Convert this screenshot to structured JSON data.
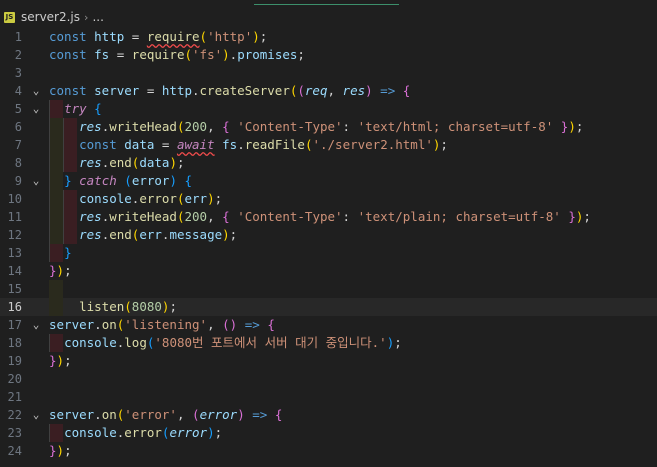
{
  "breadcrumb": {
    "file_badge": "JS",
    "file_name": "server2.js",
    "chevron": "›",
    "ellipsis": "..."
  },
  "editor": {
    "current_line": 16,
    "lines": [
      {
        "n": "1",
        "fold": "",
        "tokens": [
          [
            "kw",
            "const "
          ],
          [
            "var",
            "http"
          ],
          [
            "op",
            " = "
          ],
          [
            "fn squig",
            "require"
          ],
          [
            "brk1",
            "("
          ],
          [
            "str",
            "'http'"
          ],
          [
            "brk1",
            ")"
          ],
          [
            "op",
            ";"
          ]
        ]
      },
      {
        "n": "2",
        "fold": "",
        "tokens": [
          [
            "kw",
            "const "
          ],
          [
            "var",
            "fs"
          ],
          [
            "op",
            " = "
          ],
          [
            "fn",
            "require"
          ],
          [
            "brk1",
            "("
          ],
          [
            "str",
            "'fs'"
          ],
          [
            "brk1",
            ")"
          ],
          [
            "op",
            "."
          ],
          [
            "var",
            "promises"
          ],
          [
            "op",
            ";"
          ]
        ]
      },
      {
        "n": "3",
        "fold": "",
        "tokens": []
      },
      {
        "n": "4",
        "fold": "⌄",
        "tokens": [
          [
            "kw",
            "const "
          ],
          [
            "var",
            "server"
          ],
          [
            "op",
            " = "
          ],
          [
            "var",
            "http"
          ],
          [
            "op",
            "."
          ],
          [
            "fn",
            "createServer"
          ],
          [
            "brk1",
            "("
          ],
          [
            "brk2",
            "("
          ],
          [
            "param",
            "req"
          ],
          [
            "op",
            ", "
          ],
          [
            "param",
            "res"
          ],
          [
            "brk2",
            ")"
          ],
          [
            "kw",
            " => "
          ],
          [
            "brk2",
            "{"
          ]
        ]
      },
      {
        "n": "5",
        "fold": "⌄",
        "tokens": [
          [
            "op",
            "  "
          ],
          [
            "ctl",
            "try"
          ],
          [
            "op",
            " "
          ],
          [
            "brk3",
            "{"
          ]
        ]
      },
      {
        "n": "6",
        "fold": "",
        "tokens": [
          [
            "op",
            "    "
          ],
          [
            "param",
            "res"
          ],
          [
            "op",
            "."
          ],
          [
            "fn",
            "writeHead"
          ],
          [
            "brk1",
            "("
          ],
          [
            "num",
            "200"
          ],
          [
            "op",
            ", "
          ],
          [
            "brk2",
            "{ "
          ],
          [
            "str",
            "'Content-Type'"
          ],
          [
            "op",
            ": "
          ],
          [
            "str",
            "'text/html; charset=utf-8'"
          ],
          [
            "brk2",
            " }"
          ],
          [
            "brk1",
            ")"
          ],
          [
            "op",
            ";"
          ]
        ]
      },
      {
        "n": "7",
        "fold": "",
        "tokens": [
          [
            "op",
            "    "
          ],
          [
            "kw",
            "const "
          ],
          [
            "var",
            "data"
          ],
          [
            "op",
            " = "
          ],
          [
            "ctl squig",
            "await"
          ],
          [
            "op",
            " "
          ],
          [
            "var",
            "fs"
          ],
          [
            "op",
            "."
          ],
          [
            "fn",
            "readFile"
          ],
          [
            "brk1",
            "("
          ],
          [
            "str",
            "'./server2.html'"
          ],
          [
            "brk1",
            ")"
          ],
          [
            "op",
            ";"
          ]
        ]
      },
      {
        "n": "8",
        "fold": "",
        "tokens": [
          [
            "op",
            "    "
          ],
          [
            "param",
            "res"
          ],
          [
            "op",
            "."
          ],
          [
            "fn",
            "end"
          ],
          [
            "brk1",
            "("
          ],
          [
            "var",
            "data"
          ],
          [
            "brk1",
            ")"
          ],
          [
            "op",
            ";"
          ]
        ]
      },
      {
        "n": "9",
        "fold": "⌄",
        "tokens": [
          [
            "op",
            "  "
          ],
          [
            "brk3",
            "}"
          ],
          [
            "op",
            " "
          ],
          [
            "ctl",
            "catch"
          ],
          [
            "op",
            " "
          ],
          [
            "brk3",
            "("
          ],
          [
            "var",
            "error"
          ],
          [
            "brk3",
            ")"
          ],
          [
            "op",
            " "
          ],
          [
            "brk3",
            "{"
          ]
        ]
      },
      {
        "n": "10",
        "fold": "",
        "tokens": [
          [
            "op",
            "    "
          ],
          [
            "var",
            "console"
          ],
          [
            "op",
            "."
          ],
          [
            "fn",
            "error"
          ],
          [
            "brk1",
            "("
          ],
          [
            "var",
            "err"
          ],
          [
            "brk1",
            ")"
          ],
          [
            "op",
            ";"
          ]
        ]
      },
      {
        "n": "11",
        "fold": "",
        "tokens": [
          [
            "op",
            "    "
          ],
          [
            "param",
            "res"
          ],
          [
            "op",
            "."
          ],
          [
            "fn",
            "writeHead"
          ],
          [
            "brk1",
            "("
          ],
          [
            "num",
            "200"
          ],
          [
            "op",
            ", "
          ],
          [
            "brk2",
            "{ "
          ],
          [
            "str",
            "'Content-Type'"
          ],
          [
            "op",
            ": "
          ],
          [
            "str",
            "'text/plain; charset=utf-8'"
          ],
          [
            "brk2",
            " }"
          ],
          [
            "brk1",
            ")"
          ],
          [
            "op",
            ";"
          ]
        ]
      },
      {
        "n": "12",
        "fold": "",
        "tokens": [
          [
            "op",
            "    "
          ],
          [
            "param",
            "res"
          ],
          [
            "op",
            "."
          ],
          [
            "fn",
            "end"
          ],
          [
            "brk1",
            "("
          ],
          [
            "var",
            "err"
          ],
          [
            "op",
            "."
          ],
          [
            "var",
            "message"
          ],
          [
            "brk1",
            ")"
          ],
          [
            "op",
            ";"
          ]
        ]
      },
      {
        "n": "13",
        "fold": "",
        "tokens": [
          [
            "op",
            "  "
          ],
          [
            "brk3",
            "}"
          ]
        ]
      },
      {
        "n": "14",
        "fold": "",
        "tokens": [
          [
            "brk2",
            "}"
          ],
          [
            "brk1",
            ")"
          ],
          [
            "op",
            ";"
          ]
        ]
      },
      {
        "n": "15",
        "fold": "",
        "tokens": []
      },
      {
        "n": "16",
        "fold": "",
        "tokens": [
          [
            "op",
            "    "
          ],
          [
            "fn",
            "listen"
          ],
          [
            "brk1",
            "("
          ],
          [
            "num",
            "8080"
          ],
          [
            "brk1",
            ")"
          ],
          [
            "op",
            ";"
          ]
        ]
      },
      {
        "n": "17",
        "fold": "⌄",
        "tokens": [
          [
            "var",
            "server"
          ],
          [
            "op",
            "."
          ],
          [
            "fn",
            "on"
          ],
          [
            "brk1",
            "("
          ],
          [
            "str",
            "'listening'"
          ],
          [
            "op",
            ", "
          ],
          [
            "brk2",
            "()"
          ],
          [
            "kw",
            " => "
          ],
          [
            "brk2",
            "{"
          ]
        ]
      },
      {
        "n": "18",
        "fold": "",
        "tokens": [
          [
            "op",
            "  "
          ],
          [
            "var",
            "console"
          ],
          [
            "op",
            "."
          ],
          [
            "fn",
            "log"
          ],
          [
            "brk3",
            "("
          ],
          [
            "str",
            "'8080번 포트에서 서버 대기 중입니다.'"
          ],
          [
            "brk3",
            ")"
          ],
          [
            "op",
            ";"
          ]
        ]
      },
      {
        "n": "19",
        "fold": "",
        "tokens": [
          [
            "brk2",
            "}"
          ],
          [
            "brk1",
            ")"
          ],
          [
            "op",
            ";"
          ]
        ]
      },
      {
        "n": "20",
        "fold": "",
        "tokens": []
      },
      {
        "n": "21",
        "fold": "",
        "tokens": []
      },
      {
        "n": "22",
        "fold": "⌄",
        "tokens": [
          [
            "var",
            "server"
          ],
          [
            "op",
            "."
          ],
          [
            "fn",
            "on"
          ],
          [
            "brk1",
            "("
          ],
          [
            "str",
            "'error'"
          ],
          [
            "op",
            ", "
          ],
          [
            "brk2",
            "("
          ],
          [
            "param",
            "error"
          ],
          [
            "brk2",
            ")"
          ],
          [
            "kw",
            " => "
          ],
          [
            "brk2",
            "{"
          ]
        ]
      },
      {
        "n": "23",
        "fold": "",
        "tokens": [
          [
            "op",
            "  "
          ],
          [
            "var",
            "console"
          ],
          [
            "op",
            "."
          ],
          [
            "fn",
            "error"
          ],
          [
            "brk3",
            "("
          ],
          [
            "param",
            "error"
          ],
          [
            "brk3",
            ")"
          ],
          [
            "op",
            ";"
          ]
        ]
      },
      {
        "n": "24",
        "fold": "",
        "tokens": [
          [
            "brk2",
            "}"
          ],
          [
            "brk1",
            ")"
          ],
          [
            "op",
            ";"
          ]
        ]
      }
    ]
  }
}
